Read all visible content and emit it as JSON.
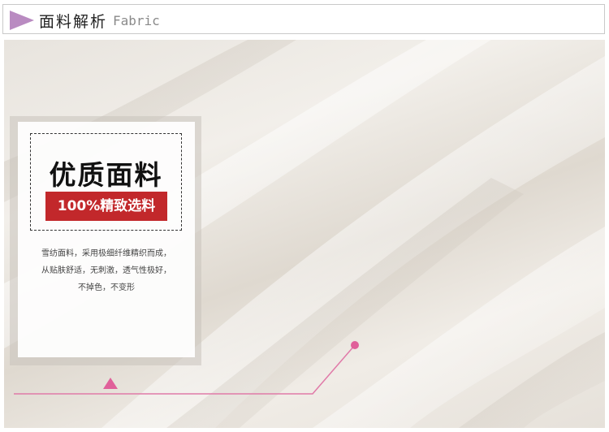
{
  "header": {
    "title_cn": "面料解析",
    "title_en": "Fabric",
    "accent_color": "#b98bc1"
  },
  "card": {
    "headline": "优质面料",
    "badge": "100%精致选料",
    "badge_color": "#c2282b",
    "description": [
      "雪纺面料，采用极细纤维精织而成，",
      "从贴肤舒适，无刺激，透气性极好，",
      "不掉色，不变形"
    ]
  },
  "decor": {
    "line_color": "#e07aa8",
    "icons": [
      "triangle-marker-icon",
      "dot-marker-icon"
    ]
  }
}
